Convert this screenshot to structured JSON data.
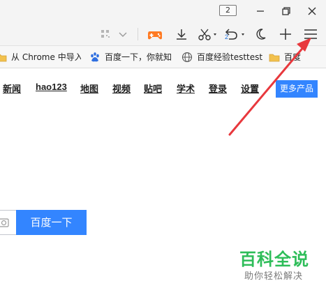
{
  "titlebar": {
    "tab_count": "2"
  },
  "toolbar": {
    "icons": [
      "qr-code-icon",
      "chevron-down-icon",
      "game-controller-icon",
      "download-icon",
      "scissors-icon",
      "undo-icon",
      "moon-icon",
      "plus-icon",
      "menu-icon"
    ],
    "undo_badge": "2"
  },
  "bookmarks": [
    {
      "label": "从 Chrome 中导入",
      "icon": "folder-icon"
    },
    {
      "label": "百度一下，你就知道",
      "icon": "baidu-paw-icon"
    },
    {
      "label": "百度经验testtest",
      "icon": "globe-icon"
    },
    {
      "label": "百度",
      "icon": "folder-icon"
    }
  ],
  "nav": {
    "links": [
      "新闻",
      "hao123",
      "地图",
      "视频",
      "贴吧",
      "学术",
      "登录",
      "设置"
    ],
    "more": "更多产品"
  },
  "search": {
    "button": "百度一下"
  },
  "watermark": {
    "title": "百科全说",
    "subtitle": "助你轻松解决"
  },
  "colors": {
    "accent": "#3385ff",
    "arrow": "#e8383d",
    "watermark": "#2ebd59",
    "game_icon": "#ff7a22"
  }
}
